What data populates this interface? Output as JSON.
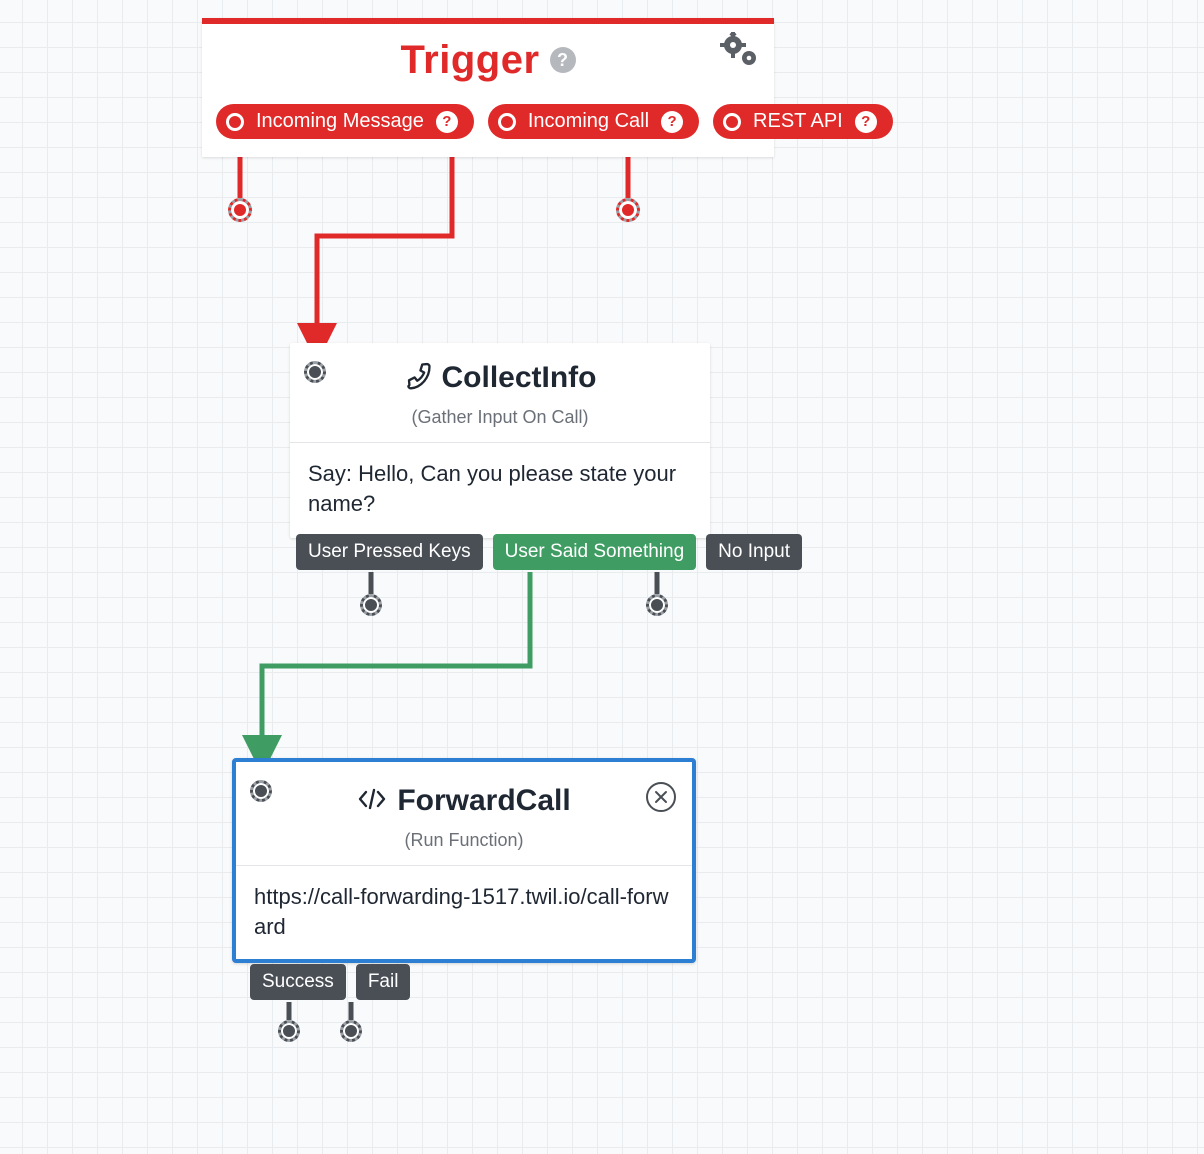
{
  "trigger": {
    "title": "Trigger",
    "pills": [
      {
        "label": "Incoming Message"
      },
      {
        "label": "Incoming Call"
      },
      {
        "label": "REST API"
      }
    ]
  },
  "collect": {
    "title": "CollectInfo",
    "subtitle": "(Gather Input On Call)",
    "body": "Say: Hello, Can you please state your name?",
    "outlets": [
      {
        "label": "User Pressed Keys"
      },
      {
        "label": "User Said Something"
      },
      {
        "label": "No Input"
      }
    ]
  },
  "forward": {
    "title": "ForwardCall",
    "subtitle": "(Run Function)",
    "body": "https://call-forwarding-1517.twil.io/call-forward",
    "outlets": [
      {
        "label": "Success"
      },
      {
        "label": "Fail"
      }
    ]
  },
  "colors": {
    "red": "#e02a2a",
    "green": "#3f9d63",
    "blue": "#2d7fd3",
    "gray": "#4a4f56"
  }
}
